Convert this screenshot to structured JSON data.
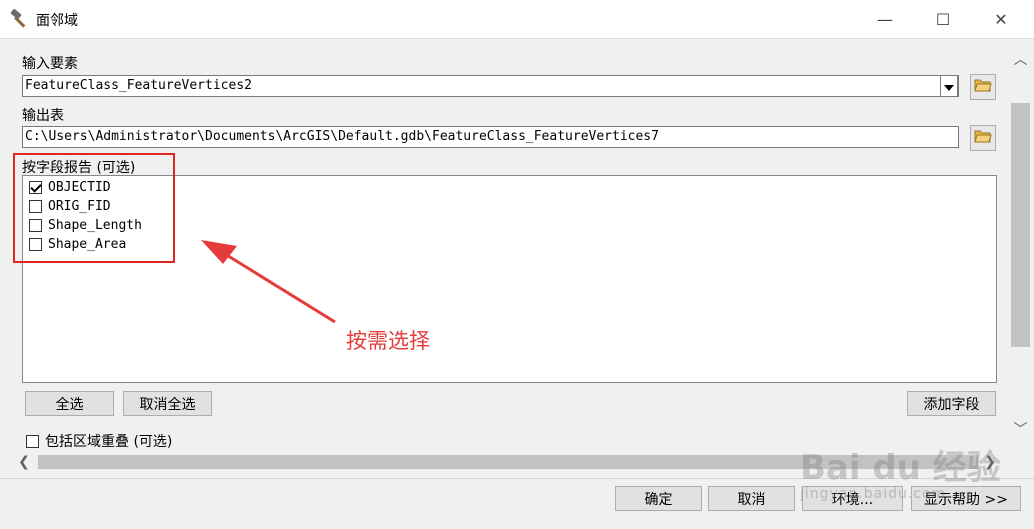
{
  "window": {
    "title": "面邻域",
    "minimize_glyph": "—",
    "maximize_glyph": "☐",
    "close_glyph": "✕"
  },
  "input_features": {
    "label": "输入要素",
    "value": "FeatureClass_FeatureVertices2"
  },
  "output_table": {
    "label": "输出表",
    "value": "C:\\Users\\Administrator\\Documents\\ArcGIS\\Default.gdb\\FeatureClass_FeatureVertices7"
  },
  "report_fields": {
    "label": "按字段报告 (可选)",
    "items": [
      {
        "label": "OBJECTID",
        "checked": true
      },
      {
        "label": "ORIG_FID",
        "checked": false
      },
      {
        "label": "Shape_Length",
        "checked": false
      },
      {
        "label": "Shape_Area",
        "checked": false
      }
    ],
    "select_all": "全选",
    "deselect_all": "取消全选",
    "add_field": "添加字段"
  },
  "annotation": {
    "text": "按需选择",
    "color": "#e53b3b"
  },
  "include_overlap": {
    "label": "包括区域重叠 (可选)",
    "checked": false
  },
  "footer": {
    "ok": "确定",
    "cancel": "取消",
    "environments": "环境...",
    "show_help": "显示帮助 >>"
  },
  "watermark": {
    "text": "Bai du 经验",
    "sub": "jingyan.baidu.com"
  },
  "icons": {
    "title": "hammer-icon",
    "browse": "folder-open-icon"
  }
}
